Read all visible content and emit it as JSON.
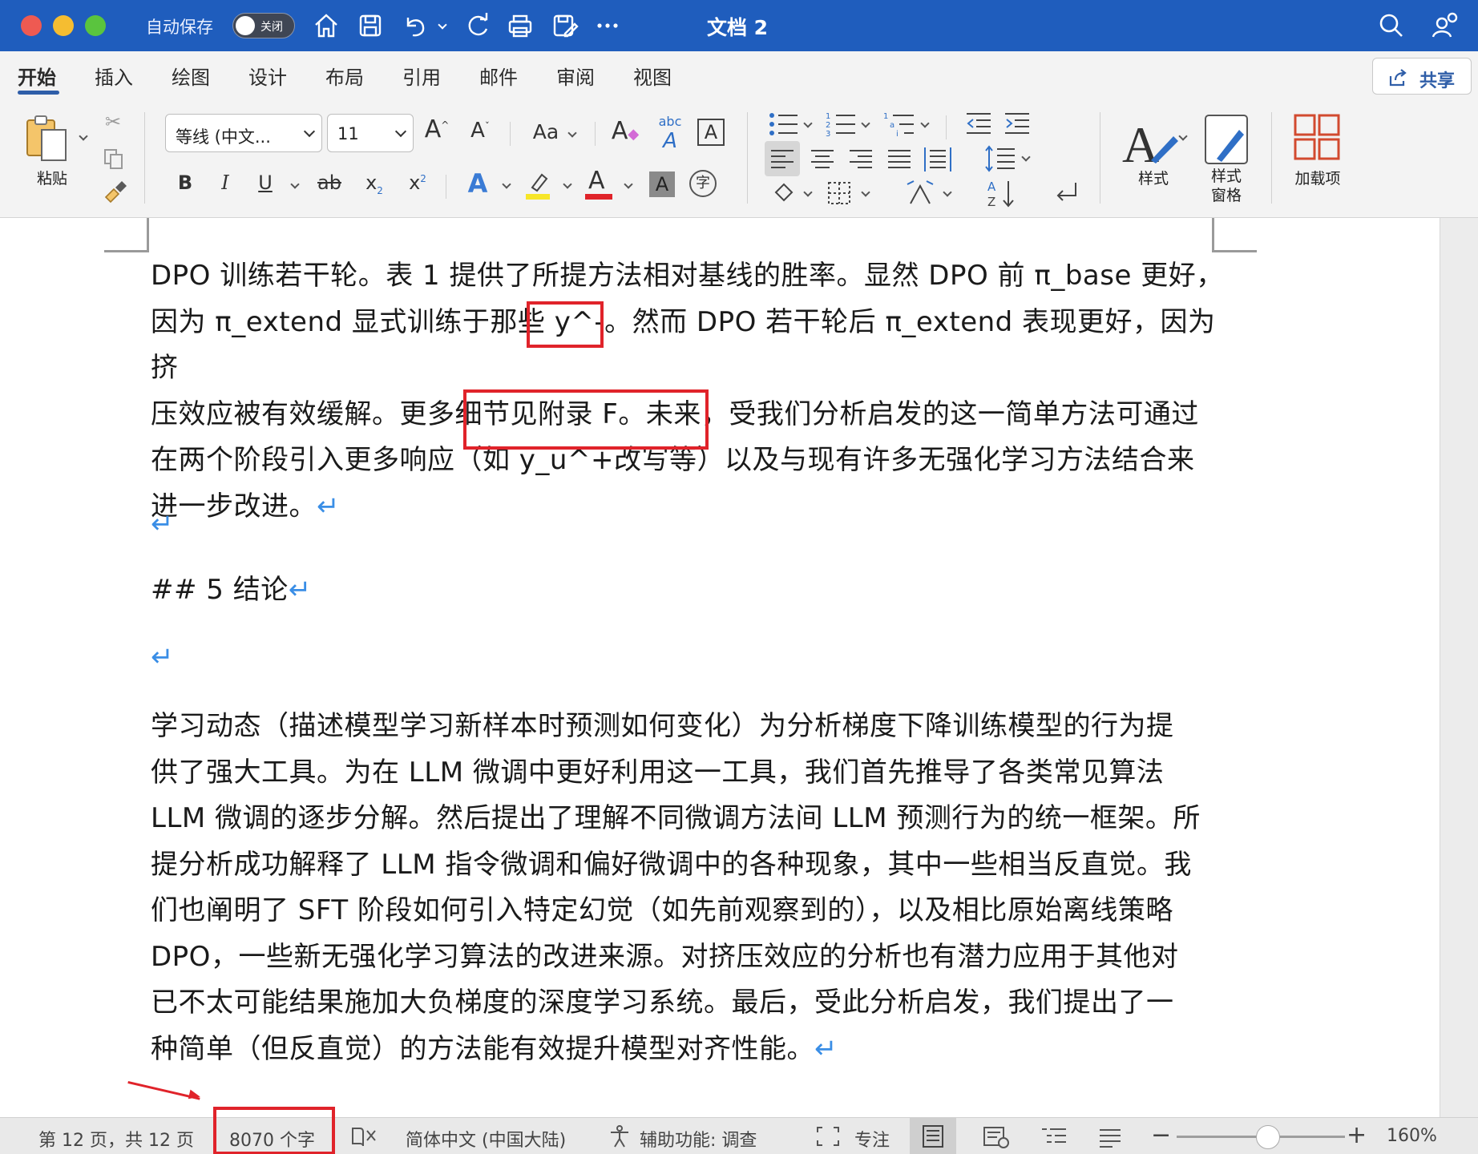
{
  "titlebar": {
    "autosave_label": "自动保存",
    "autosave_toggle": "关闭",
    "doc_title": "文档 2",
    "icons": [
      "home-icon",
      "save-icon",
      "undo-icon",
      "redo-icon",
      "print-icon",
      "save-as-icon",
      "more-icon",
      "search-icon",
      "account-icon"
    ]
  },
  "ribbon": {
    "tabs": [
      "开始",
      "插入",
      "绘图",
      "设计",
      "布局",
      "引用",
      "邮件",
      "审阅",
      "视图"
    ],
    "share_label": "共享",
    "paste_label": "粘贴",
    "font_name": "等线 (中文...",
    "font_size": "11",
    "styles_label": "样式",
    "styles_pane_label_1": "样式",
    "styles_pane_label_2": "窗格",
    "addins_label": "加载项"
  },
  "document": {
    "para1": "DPO 训练若干轮。表 1 提供了所提方法相对基线的胜率。显然 DPO 前 π_base 更好，因为 π_extend 显式训练于那些 y^-。然而 DPO 若干轮后 π_extend 表现更好，因为挤压效应被有效缓解。更多细节见附录 F。未来，受我们分析启发的这一简单方法可通过在两个阶段引入更多响应（如 y_u^+改写等）以及与现有许多无强化学习方法结合来进一步改进。",
    "para1_lines": [
      "DPO 训练若干轮。表 1 提供了所提方法相对基线的胜率。显然 DPO 前 π_base 更好，",
      "因为 π_extend 显式训练于那些 y^-。然而 DPO 若干轮后 π_extend 表现更好，因为挤",
      "压效应被有效缓解。更多细节见附录 F。未来，受我们分析启发的这一简单方法可通过",
      "在两个阶段引入更多响应（如 y_u^+改写等）以及与现有许多无强化学习方法结合来",
      "进一步改进。"
    ],
    "heading": "## 5  结论",
    "para2_lines": [
      "学习动态（描述模型学习新样本时预测如何变化）为分析梯度下降训练模型的行为提",
      "供了强大工具。为在 LLM 微调中更好利用这一工具，我们首先推导了各类常见算法",
      "LLM 微调的逐步分解。然后提出了理解不同微调方法间 LLM 预测行为的统一框架。所",
      "提分析成功解释了 LLM 指令微调和偏好微调中的各种现象，其中一些相当反直觉。我",
      "们也阐明了 SFT 阶段如何引入特定幻觉（如先前观察到的），以及相比原始离线策略",
      "DPO，一些新无强化学习算法的改进来源。对挤压效应的分析也有潜力应用于其他对",
      "已不太可能结果施加大负梯度的深度学习系统。最后，受此分析启发，我们提出了一",
      "种简单（但反直觉）的方法能有效提升模型对齐性能。"
    ],
    "pilcrow": "↵"
  },
  "statusbar": {
    "page_info": "第 12 页，共 12 页",
    "word_count": "8070 个字",
    "language": "简体中文 (中国大陆)",
    "accessibility": "辅助功能: 调查",
    "focus": "专注",
    "zoom": "160%"
  },
  "colors": {
    "titlebar": "#1f5dbd",
    "annotation_red": "#e0232a",
    "paragraph_mark": "#3a8ee6"
  }
}
